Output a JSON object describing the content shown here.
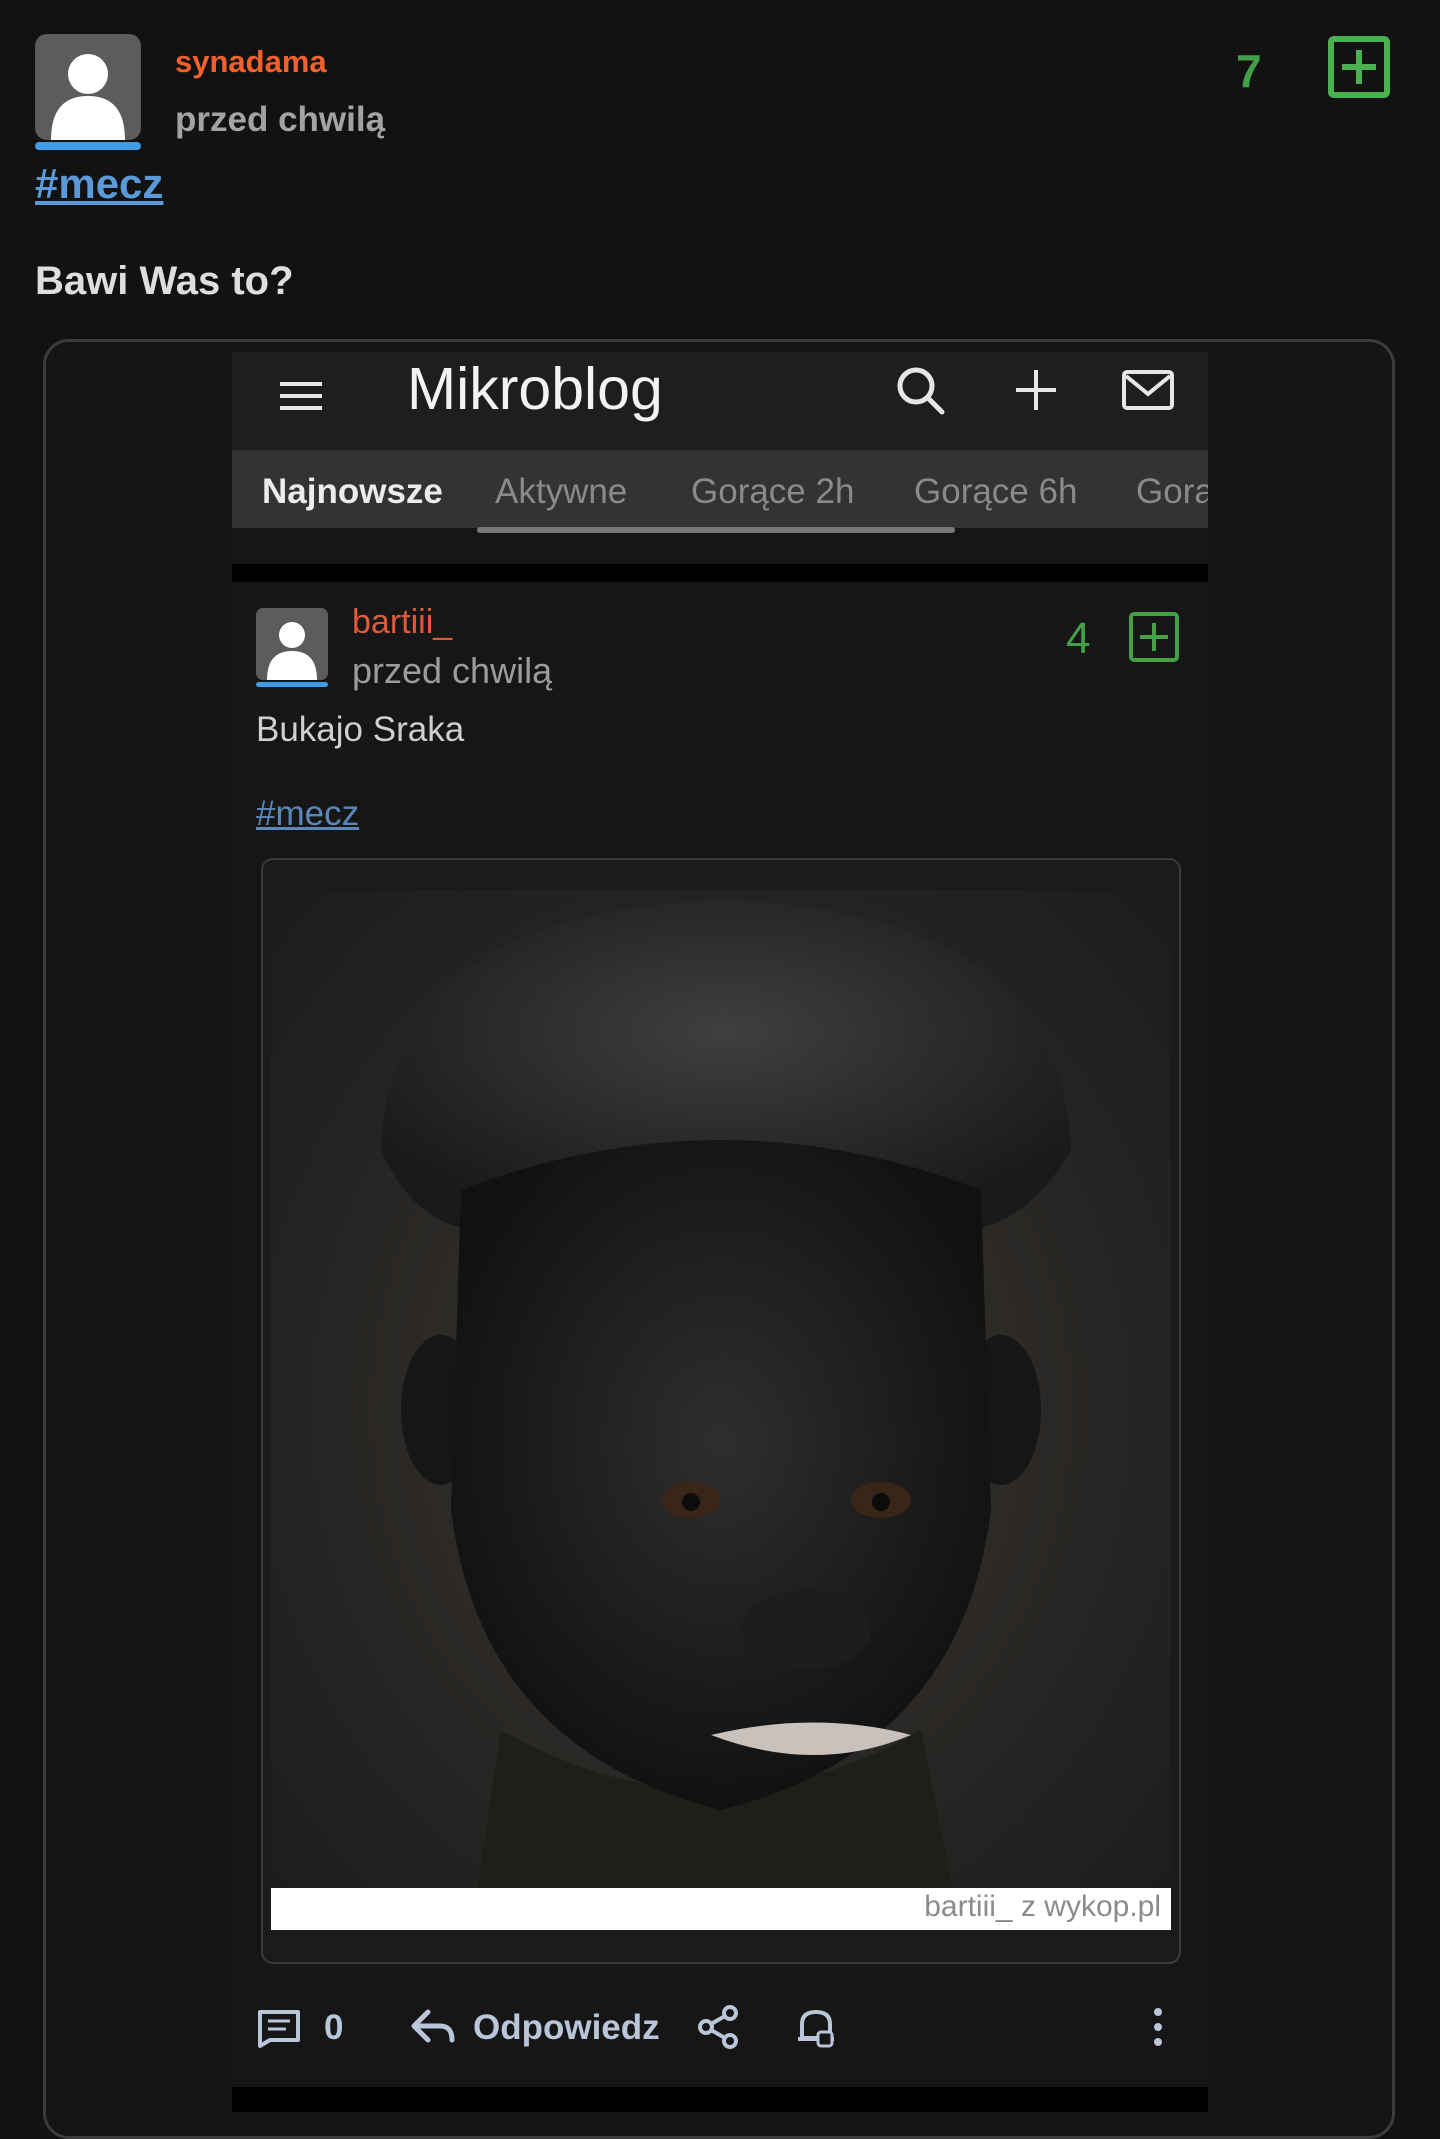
{
  "post": {
    "username": "synadama",
    "timestamp": "przed chwilą",
    "vote_count": "7",
    "tag": "#mecz",
    "body": "Bawi Was to?"
  },
  "embedded": {
    "app_title": "Mikroblog",
    "tabs": [
      "Najnowsze",
      "Aktywne",
      "Gorące 2h",
      "Gorące 6h",
      "Gorą"
    ],
    "entry": {
      "username": "bartiii_",
      "timestamp": "przed chwilą",
      "vote_count": "4",
      "body": "Bukajo Sraka",
      "tag": "#mecz",
      "watermark": "bartiii_  z  wykop.pl"
    },
    "actions": {
      "comment_count": "0",
      "reply_label": "Odpowiedz"
    }
  },
  "colors": {
    "background": "#121212",
    "username": "#f2612c",
    "vote_green": "#43a047",
    "link_blue": "#5b9ad8"
  },
  "icons": [
    "user-avatar-icon",
    "plus-vote-icon",
    "menu-icon",
    "search-icon",
    "add-icon",
    "mail-icon",
    "comment-icon",
    "reply-icon",
    "share-icon",
    "bell-icon",
    "more-vertical-icon"
  ]
}
